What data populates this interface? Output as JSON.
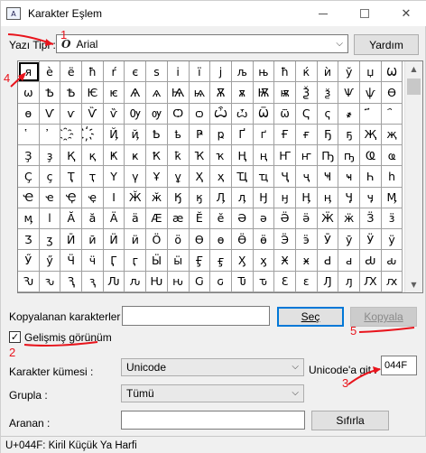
{
  "window": {
    "title": "Karakter Eşlem",
    "icon_glyph": "A"
  },
  "font_row": {
    "label": "Yazı Tipi :",
    "font_icon": "O",
    "font_value": "Arial",
    "help_button": "Yardım"
  },
  "grid": {
    "selected_index": 0,
    "chars": [
      "я",
      "è",
      "ë",
      "ħ",
      "ŕ",
      "є",
      "s",
      "i",
      "ï",
      "j",
      "љ",
      "њ",
      "ħ",
      "ќ",
      "ѝ",
      "ў",
      "џ",
      "Ѡ",
      "ѡ",
      "Ѣ",
      "Ѣ",
      "Ѥ",
      "ѥ",
      "Ѧ",
      "ѧ",
      "Ѩ",
      "ѩ",
      "Ѫ",
      "ѫ",
      "Ѭ",
      "ѭ",
      "Ѯ",
      "ѯ",
      "Ѱ",
      "ѱ",
      "Ѳ",
      "ѳ",
      "Ѵ",
      "ѵ",
      "Ѷ",
      "ѷ",
      "Ѹ",
      "ѹ",
      "Ѻ",
      "ѻ",
      "Ѽ",
      "ѽ",
      "Ѿ",
      "ѿ",
      "Ҁ",
      "ҁ",
      "҂",
      "҃",
      "҄",
      "҅",
      "҆",
      "҈",
      "҉",
      "Ҋ",
      "ҋ",
      "Ҍ",
      "ҍ",
      "Ҏ",
      "ҏ",
      "Ґ",
      "ґ",
      "Ғ",
      "ғ",
      "Ҕ",
      "ҕ",
      "Җ",
      "җ",
      "Ҙ",
      "ҙ",
      "Қ",
      "қ",
      "Ҝ",
      "ҝ",
      "Ҟ",
      "ҟ",
      "Ҡ",
      "ҡ",
      "Ң",
      "ң",
      "Ҥ",
      "ҥ",
      "Ҧ",
      "ҧ",
      "Ҩ",
      "ҩ",
      "Ҫ",
      "ҫ",
      "Ҭ",
      "ҭ",
      "Ү",
      "ү",
      "Ұ",
      "ұ",
      "Ҳ",
      "ҳ",
      "Ҵ",
      "ҵ",
      "Ҷ",
      "ҷ",
      "Ҹ",
      "ҹ",
      "Һ",
      "һ",
      "Ҽ",
      "ҽ",
      "Ҿ",
      "ҿ",
      "Ӏ",
      "Ӂ",
      "ӂ",
      "Ӄ",
      "ӄ",
      "Ӆ",
      "ӆ",
      "Ӈ",
      "ӈ",
      "Ӊ",
      "ӊ",
      "Ӌ",
      "ӌ",
      "Ӎ",
      "ӎ",
      "ӏ",
      "Ӑ",
      "ӑ",
      "Ӓ",
      "ӓ",
      "Ӕ",
      "ӕ",
      "Ӗ",
      "ӗ",
      "Ә",
      "ә",
      "Ӛ",
      "ӛ",
      "Ӝ",
      "ӝ",
      "Ӟ",
      "ӟ",
      "Ӡ",
      "ӡ",
      "Ӣ",
      "ӣ",
      "Ӥ",
      "ӥ",
      "Ӧ",
      "ӧ",
      "Ө",
      "ө",
      "Ӫ",
      "ӫ",
      "Ӭ",
      "ӭ",
      "Ӯ",
      "ӯ",
      "Ӱ",
      "ӱ",
      "Ӳ",
      "ӳ",
      "Ӵ",
      "ӵ",
      "Ӷ",
      "ӷ",
      "Ӹ",
      "ӹ",
      "Ӻ",
      "ӻ",
      "Ӽ",
      "ӽ",
      "Ӿ",
      "ӿ",
      "Ԁ",
      "ԁ",
      "Ԃ",
      "ԃ",
      "Ԅ",
      "ԅ",
      "Ԇ",
      "ԇ",
      "Ԉ",
      "ԉ",
      "Ԋ",
      "ԋ",
      "Ԍ",
      "ԍ",
      "Ԏ",
      "ԏ",
      "Ԑ",
      "ԑ",
      "Ԓ",
      "ԓ",
      "Ԕ",
      "ԕ",
      "Ԗ",
      "ԗ",
      "Ԙ",
      "ԙ",
      "Ԛ",
      "ԛ",
      "Ԝ",
      "ԝ",
      "Ԟ",
      "ԟ",
      "Ԡ",
      "ԡ",
      "Ԣ"
    ]
  },
  "copy_row": {
    "label": "Kopyalanan karakterler :",
    "value": "",
    "select_button": "Seç",
    "copy_button": "Kopyala"
  },
  "advanced": {
    "checkbox_label": "Gelişmiş görünüm",
    "checked": true,
    "check_glyph": "✓"
  },
  "charset_row": {
    "label": "Karakter kümesi :",
    "value": "Unicode",
    "goto_label": "Unicode'a git :",
    "goto_value": "044F"
  },
  "group_row": {
    "label": "Grupla :",
    "value": "Tümü"
  },
  "search_row": {
    "label": "Aranan :",
    "value": "",
    "reset_button": "Sıfırla"
  },
  "status": {
    "text": "U+044F: Kiril Küçük Ya Harfi"
  },
  "annotations": {
    "n1": "1",
    "n2": "2",
    "n3": "3",
    "n4": "4",
    "n5": "5",
    "color": "#e8141c"
  },
  "chrome": {
    "minimize": "–",
    "close": "✕",
    "dropdown_arrow": "⌵",
    "scroll_up": "▲",
    "scroll_down": "▼"
  }
}
